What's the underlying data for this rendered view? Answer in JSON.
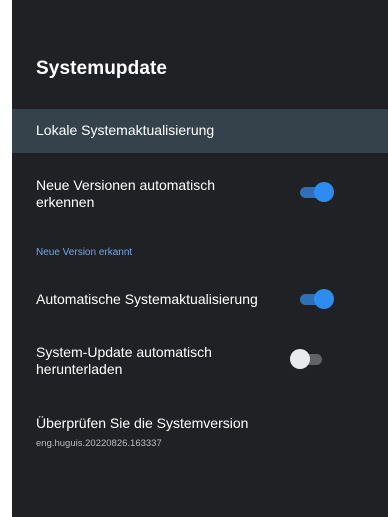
{
  "screen": {
    "title": "Systemupdate"
  },
  "menu": {
    "local_update": "Lokale Systemaktualisierung",
    "auto_detect": {
      "label": "Neue Versionen automatisch erkennen",
      "enabled": true
    },
    "section_label": "Neue Version erkannt",
    "auto_system_update": {
      "label": "Automatische Systemaktualisierung",
      "enabled": true
    },
    "auto_download": {
      "label": "System-Update automatisch herunterladen",
      "enabled": false
    },
    "check_version": {
      "label": "Überprüfen Sie die Systemversion",
      "version": "eng.huguis.20220826.163337"
    }
  },
  "colors": {
    "background": "#202124",
    "selected_row": "#35414b",
    "accent": "#2e8cf0",
    "section_text": "#6aa8ee"
  }
}
